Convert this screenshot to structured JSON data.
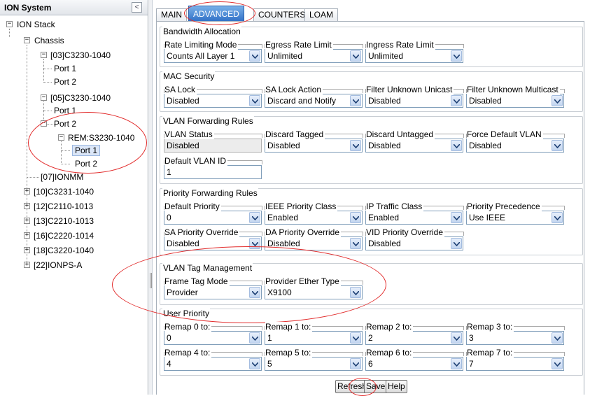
{
  "sidebar": {
    "title": "ION System",
    "collapse_icon": "<",
    "tree": {
      "root": "ION Stack",
      "chassis": "Chassis",
      "n03": "[03]C3230-1040",
      "n03_p1": "Port 1",
      "n03_p2": "Port 2",
      "n05": "[05]C3230-1040",
      "n05_p1": "Port 1",
      "n05_p2": "Port 2",
      "rem": "REM:S3230-1040",
      "rem_p1": "Port 1",
      "rem_p2": "Port 2",
      "n07": "[07]IONMM",
      "n10": "[10]C3231-1040",
      "n12": "[12]C2110-1013",
      "n13": "[13]C2210-1013",
      "n16": "[16]C2220-1014",
      "n18": "[18]C3220-1040",
      "n22": "[22]IONPS-A"
    }
  },
  "tabs": [
    "MAIN",
    "ADVANCED",
    "COUNTERS",
    "LOAM"
  ],
  "sections": {
    "bandwidth": {
      "title": "Bandwidth Allocation",
      "rate_limiting_mode": {
        "label": "Rate Limiting Mode",
        "value": "Counts All Layer 1"
      },
      "egress_rate_limit": {
        "label": "Egress Rate Limit",
        "value": "Unlimited"
      },
      "ingress_rate_limit": {
        "label": "Ingress Rate Limit",
        "value": "Unlimited"
      }
    },
    "mac_security": {
      "title": "MAC Security",
      "sa_lock": {
        "label": "SA Lock",
        "value": "Disabled"
      },
      "sa_lock_action": {
        "label": "SA Lock Action",
        "value": "Discard and Notify"
      },
      "filter_unknown_unicast": {
        "label": "Filter Unknown Unicast",
        "value": "Disabled"
      },
      "filter_unknown_multicast": {
        "label": "Filter Unknown Multicast",
        "value": "Disabled"
      }
    },
    "vlan_forwarding": {
      "title": "VLAN Forwarding Rules",
      "vlan_status": {
        "label": "VLAN Status",
        "value": "Disabled"
      },
      "discard_tagged": {
        "label": "Discard Tagged",
        "value": "Disabled"
      },
      "discard_untagged": {
        "label": "Discard Untagged",
        "value": "Disabled"
      },
      "force_default_vlan": {
        "label": "Force Default VLAN",
        "value": "Disabled"
      },
      "default_vlan_id": {
        "label": "Default VLAN ID",
        "value": "1"
      }
    },
    "priority_forwarding": {
      "title": "Priority Forwarding Rules",
      "default_priority": {
        "label": "Default Priority",
        "value": "0"
      },
      "ieee_priority_class": {
        "label": "IEEE Priority Class",
        "value": "Enabled"
      },
      "ip_traffic_class": {
        "label": "IP Traffic Class",
        "value": "Enabled"
      },
      "priority_precedence": {
        "label": "Priority Precedence",
        "value": "Use IEEE"
      },
      "sa_priority_override": {
        "label": "SA Priority Override",
        "value": "Disabled"
      },
      "da_priority_override": {
        "label": "DA Priority Override",
        "value": "Disabled"
      },
      "vid_priority_override": {
        "label": "VID Priority Override",
        "value": "Disabled"
      }
    },
    "vlan_tag": {
      "title": "VLAN Tag Management",
      "frame_tag_mode": {
        "label": "Frame Tag Mode",
        "value": "Provider"
      },
      "provider_ether_type": {
        "label": "Provider Ether Type",
        "value": "X9100"
      }
    },
    "user_priority": {
      "title": "User Priority",
      "remaps": [
        {
          "label": "Remap 0 to:",
          "value": "0"
        },
        {
          "label": "Remap 1 to:",
          "value": "1"
        },
        {
          "label": "Remap 2 to:",
          "value": "2"
        },
        {
          "label": "Remap 3 to:",
          "value": "3"
        },
        {
          "label": "Remap 4 to:",
          "value": "4"
        },
        {
          "label": "Remap 5 to:",
          "value": "5"
        },
        {
          "label": "Remap 6 to:",
          "value": "6"
        },
        {
          "label": "Remap 7 to:",
          "value": "7"
        }
      ]
    }
  },
  "buttons": {
    "refresh": "Refresh",
    "save": "Save",
    "help": "Help"
  },
  "annotation_color": "#e22b2b"
}
